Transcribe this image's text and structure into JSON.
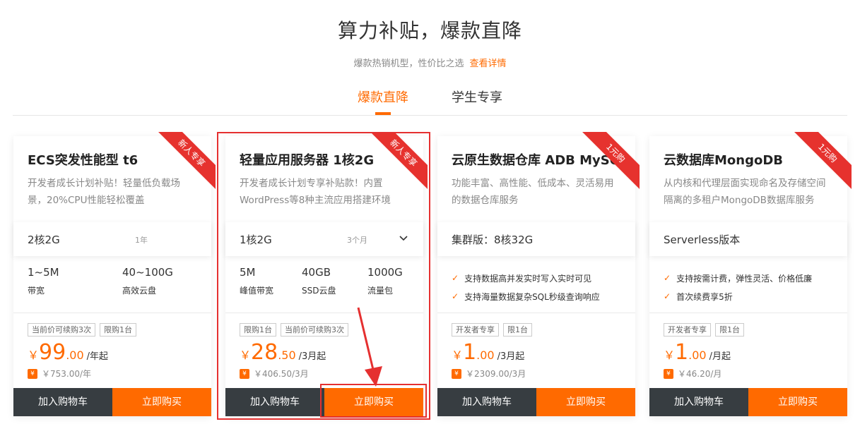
{
  "header": {
    "title": "算力补贴，爆款直降",
    "subtitle": "爆款热销机型，性价比之选",
    "detail_link": "查看详情"
  },
  "tabs": [
    {
      "label": "爆款直降",
      "active": true
    },
    {
      "label": "学生专享",
      "active": false
    }
  ],
  "colors": {
    "accent": "#ff6a00",
    "ribbon": "#e6322e",
    "cart_button": "#373d41",
    "annotation": "#e53030"
  },
  "cards": [
    {
      "title": "ECS突发性能型 t6",
      "ribbon": "新人专享",
      "desc": "开发者成长计划补贴！轻量低负载场景，20%CPU性能轻松覆盖",
      "spec": "2核2G",
      "spec_sub": "1年",
      "metrics": [
        {
          "value": "1~5M",
          "label": "带宽"
        },
        {
          "value": "40~100G",
          "label": "高效云盘"
        }
      ],
      "tags": [
        "当前价可续购3次",
        "限购1台"
      ],
      "price": {
        "currency": "￥",
        "integer": "99",
        "decimal": ".00",
        "unit": "/年起"
      },
      "original": "￥753.00/年",
      "cart_label": "加入购物车",
      "buy_label": "立即购买"
    },
    {
      "title": "轻量应用服务器 1核2G",
      "ribbon": "新人专享",
      "desc": "开发者成长计划专享补贴款！内置WordPress等8种主流应用搭建环境",
      "spec": "1核2G",
      "spec_sub": "3个月",
      "metrics": [
        {
          "value": "5M",
          "label": "峰值带宽"
        },
        {
          "value": "40GB",
          "label": "SSD云盘"
        },
        {
          "value": "1000G",
          "label": "流量包"
        }
      ],
      "tags": [
        "限购1台",
        "当前价可续购3次"
      ],
      "price": {
        "currency": "￥",
        "integer": "28",
        "decimal": ".50",
        "unit": "/3月起"
      },
      "original": "￥406.50/3月",
      "cart_label": "加入购物车",
      "buy_label": "立即购买"
    },
    {
      "title": "云原生数据仓库 ADB MySQL",
      "ribbon": "1元购",
      "desc": "功能丰富、高性能、低成本、灵活易用的数据仓库服务",
      "spec": "集群版：8核32G",
      "features": [
        "支持数据高并发实时写入实时可见",
        "支持海量数据复杂SQL秒级查询响应"
      ],
      "tags": [
        "开发者专享",
        "限1台"
      ],
      "price": {
        "currency": "￥",
        "integer": "1",
        "decimal": ".00",
        "unit": "/3月起"
      },
      "original": "￥2309.00/3月",
      "cart_label": "加入购物车",
      "buy_label": "立即购买"
    },
    {
      "title": "云数据库MongoDB",
      "ribbon": "1元购",
      "desc": "从内核和代理层面实现命名及存储空间隔离的多租户MongoDB数据库服务",
      "spec": "Serverless版本",
      "features": [
        "支持按需计费，弹性灵活、价格低廉",
        "首次续费享5折"
      ],
      "tags": [
        "开发者专享",
        "限1台"
      ],
      "price": {
        "currency": "￥",
        "integer": "1",
        "decimal": ".00",
        "unit": "/月起"
      },
      "original": "￥46.20/月",
      "cart_label": "加入购物车",
      "buy_label": "立即购买"
    }
  ]
}
